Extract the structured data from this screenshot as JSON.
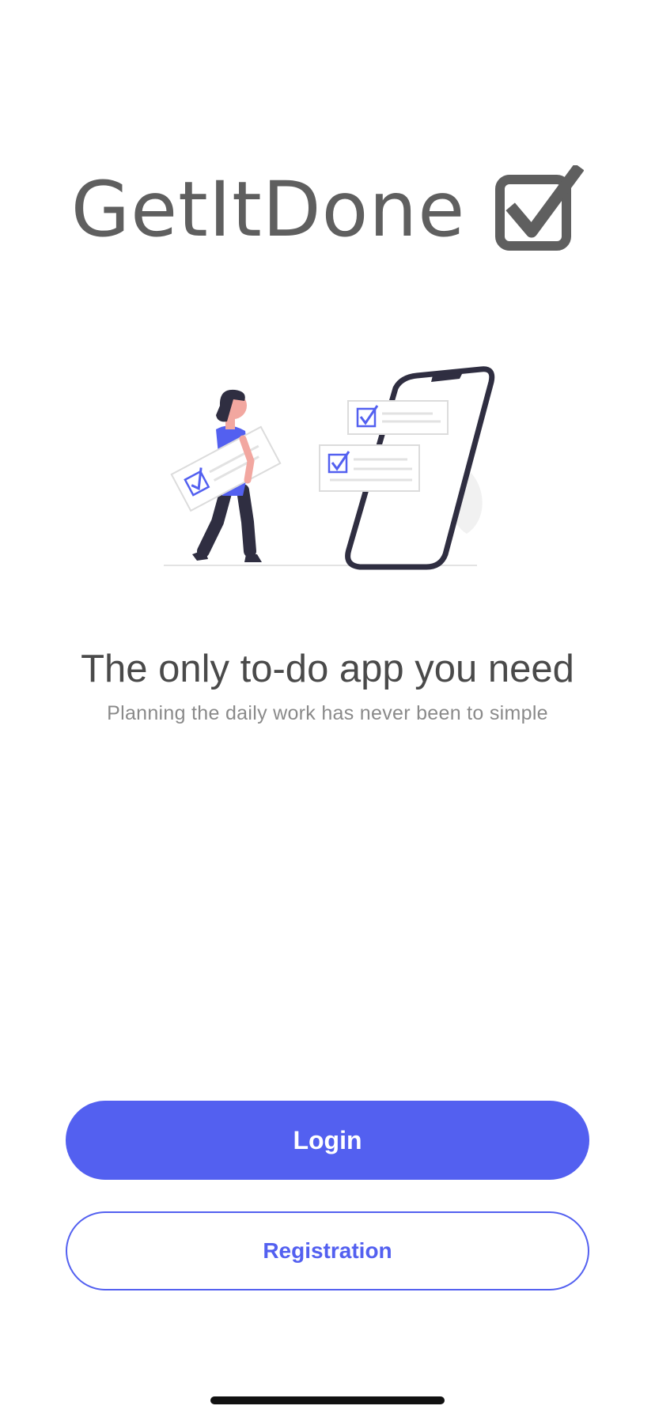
{
  "logo": {
    "text": "GetItDone",
    "icon": "checkbox-checked-icon"
  },
  "illustration": {
    "name": "person-with-checklist-and-phone-illustration"
  },
  "hero": {
    "title": "The only to-do app you need",
    "subtitle": "Planning the daily work has never been to simple"
  },
  "actions": {
    "login_label": "Login",
    "registration_label": "Registration"
  },
  "colors": {
    "accent": "#5360F0",
    "logo_gray": "#5F5F5F",
    "title_gray": "#4A4A4A",
    "subtitle_gray": "#8A8A8A",
    "skin": "#F2A7A0",
    "dark": "#2F2E41"
  }
}
